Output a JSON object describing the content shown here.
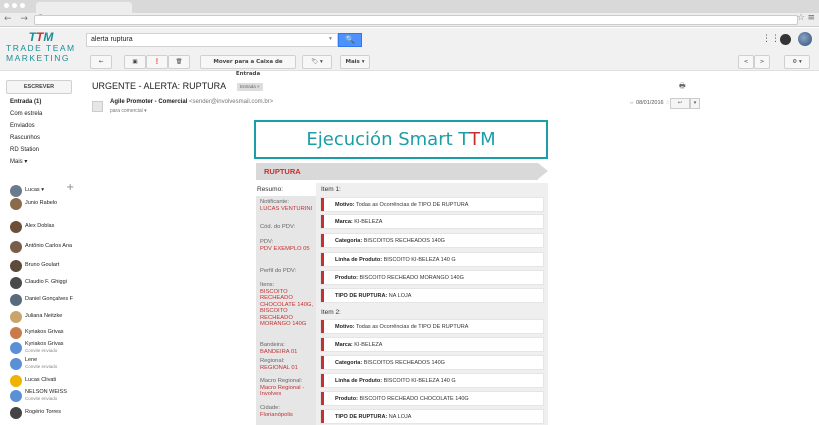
{
  "browser": {
    "nav_icons": "← → C",
    "star": "☆",
    "menu": "≡"
  },
  "logo": {
    "main": "TTM",
    "line1": "TRADE TEAM",
    "line2": "MARKETING"
  },
  "search": {
    "value": "alerta ruptura",
    "button_icon": "🔍"
  },
  "toolbar": {
    "back": "←",
    "archive": "▣",
    "spam": "❗",
    "delete": "🗑",
    "move_inbox": "Mover para a Caixa de Entrada",
    "labels": "🏷 ▾",
    "more": "Mais ▾",
    "prev": "<",
    "next": ">",
    "settings": "⚙ ▾"
  },
  "sidebar": {
    "compose": "ESCREVER",
    "folders": [
      "Entrada (1)",
      "Com estrela",
      "Enviados",
      "Rascunhos",
      "RD Station",
      "Mais ▾"
    ],
    "me": "Lucas ▾",
    "plus": "+",
    "contacts": [
      {
        "name": "Junio Rabelo",
        "sub": "",
        "color": "#8a6a4a"
      },
      {
        "name": "Alex Doblas",
        "sub": "",
        "color": "#6b4f3a"
      },
      {
        "name": "Antônio Carlos Ana",
        "sub": "",
        "color": "#7a5c4a"
      },
      {
        "name": "Bruno Goulart",
        "sub": "",
        "color": "#5c4a3a"
      },
      {
        "name": "Claudio F. Ghiggi",
        "sub": "",
        "color": "#4a4a4a"
      },
      {
        "name": "Daniel Gonçalves F",
        "sub": "",
        "color": "#5a6a7a"
      },
      {
        "name": "Juliana Neitzke",
        "sub": "",
        "color": "#c9a46b"
      },
      {
        "name": "Kyriakos Grivas",
        "sub": "",
        "color": "#c97b4a"
      },
      {
        "name": "Kyriakos Grivas",
        "sub": "Convite enviado",
        "color": "#5b8fd6"
      },
      {
        "name": "Lene",
        "sub": "Convite enviado",
        "color": "#5b8fd6"
      },
      {
        "name": "Lucas Clivati",
        "sub": "",
        "color": "#f0b400"
      },
      {
        "name": "NELSON WEISS",
        "sub": "Convite enviado",
        "color": "#5b8fd6"
      },
      {
        "name": "Rogério Torres",
        "sub": "",
        "color": "#444444"
      }
    ]
  },
  "message": {
    "subject": "URGENTE - ALERTA: RUPTURA",
    "label": "Entrada ×",
    "print": "🖶",
    "sender_name": "Agile Promoter - Comercial",
    "sender_email": "<sender@involvesmail.com.br>",
    "to": "para comercial ▾",
    "date": "08/01/2016",
    "reply": "↩ ",
    "more": "▾"
  },
  "email": {
    "banner_text": "Ejecución Smart T",
    "banner_t2": "T",
    "banner_t3": "M",
    "section": "RUPTURA",
    "summary_head": "Resumo:",
    "summary": [
      {
        "label": "Notificante:",
        "value": "LUCAS VENTURINI"
      },
      {
        "label": "Cód. do PDV:",
        "value": ""
      },
      {
        "label": "PDV:",
        "value": "PDV EXEMPLO 05"
      },
      {
        "label": "Perfil do PDV:",
        "value": ""
      },
      {
        "label": "Itens:",
        "value": "BISCOITO RECHEADO CHOCOLATE 140G, BISCOITO RECHEADO MORANGO 140G"
      },
      {
        "label": "Bandeira:",
        "value": "BANDEIRA 01"
      },
      {
        "label": "Regional:",
        "value": "REGIONAL 01"
      },
      {
        "label": "Macro Regional:",
        "value": "Macro Regional - Involves"
      },
      {
        "label": "Cidade:",
        "value": "Florianópolis"
      }
    ],
    "items": [
      {
        "head": "Item 1:",
        "rows": [
          {
            "k": "Motivo:",
            "v": "Todas as Ocorrências de TIPO DE RUPTURA"
          },
          {
            "k": "Marca:",
            "v": "KI-BELEZA"
          },
          {
            "k": "Categoria:",
            "v": "BISCOITOS RECHEADOS 140G"
          },
          {
            "k": "Linha de Produto:",
            "v": "BISCOITO KI-BELEZA 140 G"
          },
          {
            "k": "Produto:",
            "v": "BISCOITO RECHEADO MORANGO 140G"
          },
          {
            "k": "TIPO DE RUPTURA:",
            "v": "NA LOJA"
          }
        ]
      },
      {
        "head": "Item 2:",
        "rows": [
          {
            "k": "Motivo:",
            "v": "Todas as Ocorrências de TIPO DE RUPTURA"
          },
          {
            "k": "Marca:",
            "v": "KI-BELEZA"
          },
          {
            "k": "Categoria:",
            "v": "BISCOITOS RECHEADOS 140G"
          },
          {
            "k": "Linha de Produto:",
            "v": "BISCOITO KI-BELEZA 140 G"
          },
          {
            "k": "Produto:",
            "v": "BISCOITO RECHEADO CHOCOLATE 140G"
          },
          {
            "k": "TIPO DE RUPTURA:",
            "v": "NA LOJA"
          }
        ]
      }
    ]
  }
}
